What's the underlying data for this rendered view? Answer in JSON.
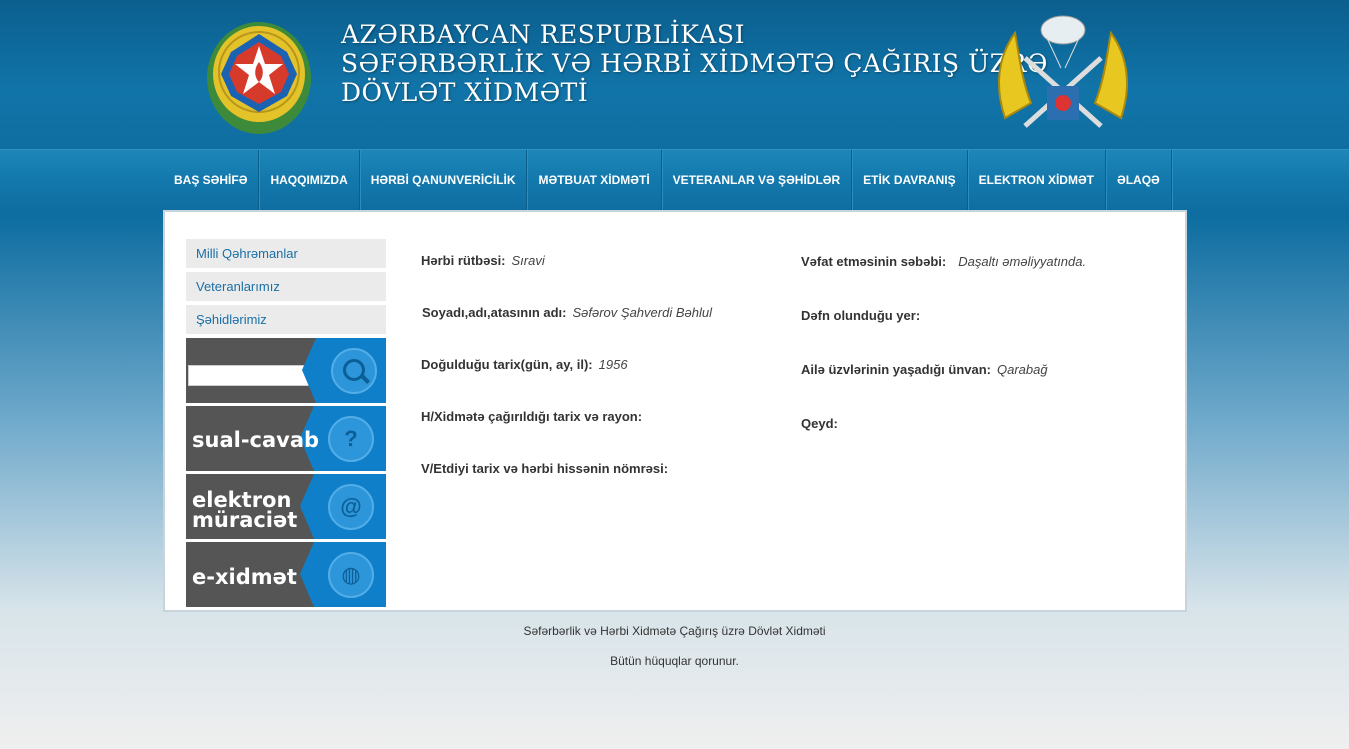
{
  "header": {
    "title_line1": "AZƏRBAYCAN RESPUBLİKASI",
    "title_line2": "SƏFƏRBƏRLİK VƏ HƏRBİ XİDMƏTƏ ÇAĞIRIŞ ÜZRƏ",
    "title_line3": "DÖVLƏT XİDMƏTİ",
    "left_emblem_icon": "state-emblem-icon",
    "right_emblem_icon": "military-insignia-icon"
  },
  "nav": {
    "items": [
      "BAŞ SƏHİFƏ",
      "HAQQIMIZDA",
      "HƏRBİ QANUNVERİCİLİK",
      "MƏTBUAT XİDMƏTİ",
      "VETERANLAR VƏ ŞƏHİDLƏR",
      "ETİK DAVRANIŞ",
      "ELEKTRON XİDMƏT",
      "ƏLAQƏ"
    ]
  },
  "sidebar": {
    "links": [
      "Milli Qəhrəmanlar",
      "Veteranlarımız",
      "Şəhidlərimiz"
    ],
    "search": {
      "value": "",
      "icon": "search-icon"
    },
    "banners": [
      {
        "line1": "sual-cavab",
        "line2": "",
        "icon": "question-bubble-icon"
      },
      {
        "line1": "elektron",
        "line2": "müraciət",
        "icon": "email-at-icon"
      },
      {
        "line1": "e-xidmət",
        "line2": "",
        "icon": "globe-icon"
      }
    ]
  },
  "details": {
    "rank_label": "Hərbi rütbəsi:",
    "rank_value": "Sıravi",
    "name_label": "Soyadı,adı,atasının adı:",
    "name_value": "Səfərov Şahverdi Bəhlul",
    "birth_label": "Doğulduğu tarix(gün, ay, il):",
    "birth_value": "1956",
    "drafted_label": "H/Xidmətə çağırıldığı tarix və rayon:",
    "drafted_value": "",
    "unit_label": "V/Etdiyi tarix və hərbi hissənin nömrəsi:",
    "unit_value": "",
    "death_reason_label": "Vəfat etməsinin səbəbi:",
    "death_reason_value": "Daşaltı əməliyyatında.",
    "burial_label": "Dəfn olunduğu yer:",
    "burial_value": "",
    "family_address_label": "Ailə üzvlərinin yaşadığı ünvan:",
    "family_address_value": "Qarabağ",
    "note_label": "Qeyd:",
    "note_value": ""
  },
  "footer": {
    "line1": "Səfərbərlik və Hərbi Xidmətə Çağırış üzrə Dövlət Xidməti",
    "line2": "Bütün hüquqlar qorunur."
  }
}
